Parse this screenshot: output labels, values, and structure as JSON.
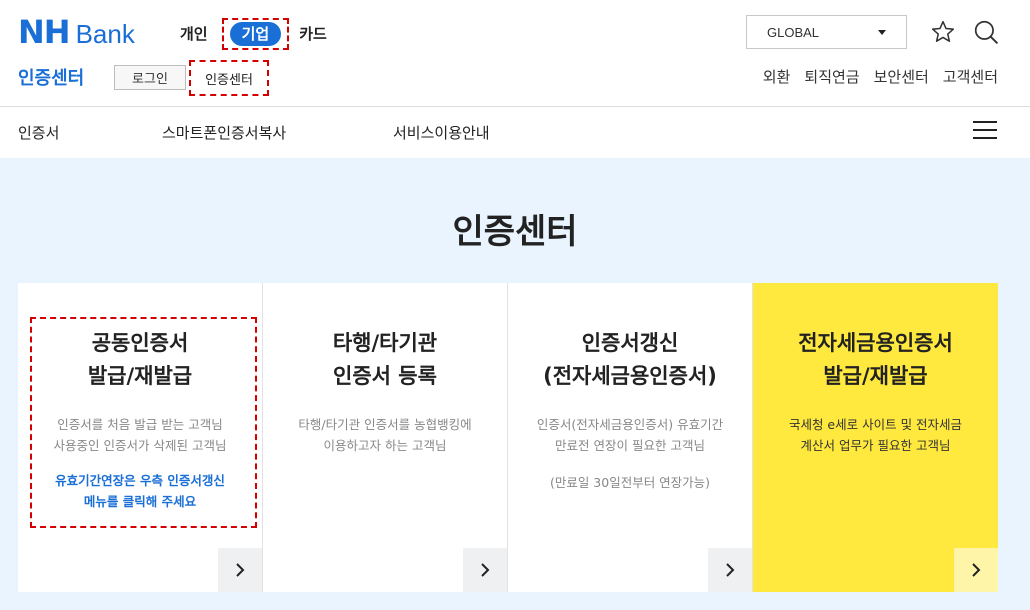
{
  "header": {
    "logo_nh": "NH",
    "logo_bank": "Bank",
    "nav": [
      "개인",
      "기업",
      "카드"
    ],
    "global_select": "GLOBAL",
    "icons": [
      "star-icon",
      "search-icon"
    ]
  },
  "subheader": {
    "section_title": "인증센터",
    "login_label": "로그인",
    "cert_center_label": "인증센터",
    "util_links": [
      "외환",
      "퇴직연금",
      "보안센터",
      "고객센터"
    ]
  },
  "menu": {
    "items": [
      "인증서",
      "스마트폰인증서복사",
      "서비스이용안내"
    ],
    "hamburger_icon": "hamburger-icon"
  },
  "hero": {
    "title": "인증센터",
    "cards": [
      {
        "title_lines": [
          "공동인증서",
          "발급/재발급"
        ],
        "desc_lines": [
          "인증서를 처음 발급 받는 고객님",
          "사용중인 인증서가 삭제된 고객님"
        ],
        "highlight_lines": [
          "유효기간연장은 우측 인증서갱신",
          "메뉴를 클릭해 주세요"
        ]
      },
      {
        "title_lines": [
          "타행/타기관",
          "인증서 등록"
        ],
        "desc_lines": [
          "타행/타기관 인증서를 농협뱅킹에",
          "이용하고자 하는 고객님"
        ]
      },
      {
        "title_lines": [
          "인증서갱신",
          "(전자세금용인증서)"
        ],
        "desc_lines": [
          "인증서(전자세금용인증서) 유효기간",
          "만료전 연장이 필요한 고객님"
        ],
        "note": "(만료일 30일전부터 연장가능)"
      },
      {
        "title_lines": [
          "전자세금용인증서",
          "발급/재발급"
        ],
        "desc_lines": [
          "국세청 e세로 사이트 및 전자세금",
          "계산서 업무가 필요한 고객님"
        ]
      }
    ]
  },
  "colors": {
    "brand_blue": "#1a6fd6",
    "hero_bg": "#e9f4fe",
    "highlight_yellow": "#ffe93e",
    "dash_red": "#d40000"
  }
}
